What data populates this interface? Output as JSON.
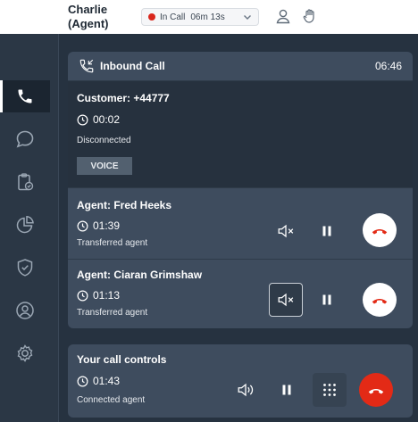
{
  "header": {
    "agent_name_line1": "Charlie",
    "agent_name_line2": "(Agent)",
    "status_label": "In Call",
    "status_timer": "06m 13s",
    "status_dot_color": "#d9261c",
    "icons": [
      "user-icon",
      "raise-hand-icon"
    ]
  },
  "sidebar": {
    "items": [
      {
        "icon": "phone-icon",
        "active": true
      },
      {
        "icon": "chat-icon",
        "active": false
      },
      {
        "icon": "clipboard-check-icon",
        "active": false
      },
      {
        "icon": "pie-chart-icon",
        "active": false
      },
      {
        "icon": "shield-check-icon",
        "active": false
      },
      {
        "icon": "user-circle-icon",
        "active": false
      },
      {
        "icon": "settings-icon",
        "active": false
      }
    ]
  },
  "inbound_call": {
    "title": "Inbound Call",
    "duration": "06:46",
    "customer": {
      "title": "Customer: +44777",
      "timer": "00:02",
      "status": "Disconnected",
      "voice_label": "VOICE"
    },
    "agents": [
      {
        "title": "Agent: Fred Heeks",
        "timer": "01:39",
        "status": "Transferred agent",
        "mute_highlighted": false
      },
      {
        "title": "Agent: Ciaran Grimshaw",
        "timer": "01:13",
        "status": "Transferred agent",
        "mute_highlighted": true
      }
    ]
  },
  "your_controls": {
    "title": "Your call controls",
    "timer": "01:43",
    "status": "Connected agent"
  },
  "colors": {
    "accent_red": "#e32a16",
    "panel_bg": "#3e4c5e",
    "sidebar_bg": "#2b3745"
  }
}
